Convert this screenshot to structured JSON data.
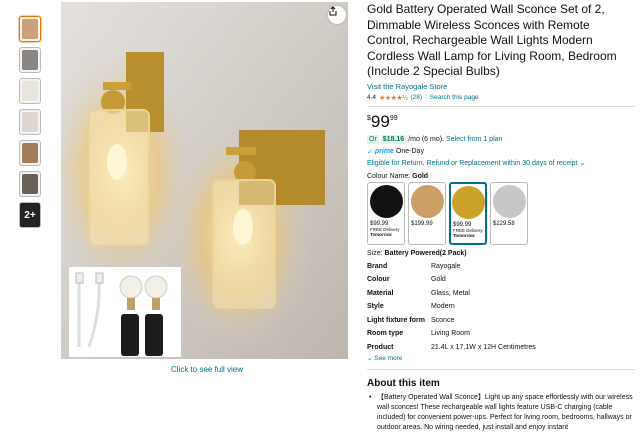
{
  "thumbnails": [
    {
      "name": "thumb-1",
      "color": "#c9a27a",
      "selected": true
    },
    {
      "name": "thumb-2",
      "color": "#8a8580",
      "selected": false
    },
    {
      "name": "thumb-3",
      "color": "#e9e5dc",
      "selected": false
    },
    {
      "name": "thumb-4",
      "color": "#dcd8cf",
      "selected": false
    },
    {
      "name": "thumb-5",
      "color": "#a37c58",
      "selected": false
    },
    {
      "name": "thumb-6",
      "color": "#6a6259",
      "selected": false
    }
  ],
  "thumb_more_label": "2+",
  "zoom_link": "Click to see full view",
  "product": {
    "title": "Gold Battery Operated Wall Sconce Set of 2, Dimmable Wireless Sconces with Remote Control, Rechargeable Wall Lights Modern Cordless Wall Lamp for Living Room, Bedroom (Include 2 Special Bulbs)",
    "store_link": "Visit the Rayogale Store",
    "rating": "4.4",
    "stars": "★★★★½",
    "reviews": "(28)",
    "search_link": "Search this page",
    "price_currency": "$",
    "price_whole": "99",
    "price_fraction": "99",
    "monthly_or": "Or",
    "monthly_amount": "$18.16",
    "monthly_text": "/mo (6 mo).",
    "monthly_link": "Select from 1 plan",
    "prime_check": "✓",
    "prime_logo": "prime",
    "prime_text": "One-Day",
    "eligible": "Eligible for Return, Refund or Replacement within 30 days of receipt ⌄",
    "colour_label": "Colour Name:",
    "colour_value": "Gold",
    "size_label": "Size:",
    "size_value": "Battery Powered(2 Pack)"
  },
  "swatches": [
    {
      "color": "#111111",
      "price": "$99.99",
      "delivery_1": "FREE Delivery",
      "delivery_2": "Tomorrow",
      "selected": false
    },
    {
      "color": "#caa066",
      "price": "$199.99",
      "delivery_1": "",
      "delivery_2": "",
      "selected": false
    },
    {
      "color": "#c9a227",
      "price": "$99.99",
      "delivery_1": "FREE Delivery",
      "delivery_2": "Tomorrow",
      "selected": true
    },
    {
      "color": "#c7c7c7",
      "price": "$229.58",
      "delivery_1": "",
      "delivery_2": "",
      "selected": false
    }
  ],
  "specs": [
    {
      "k": "Brand",
      "v": "Rayogale"
    },
    {
      "k": "Colour",
      "v": "Gold"
    },
    {
      "k": "Material",
      "v": "Glass, Metal"
    },
    {
      "k": "Style",
      "v": "Modern"
    },
    {
      "k": "Light fixture form",
      "v": "Sconce"
    },
    {
      "k": "Room type",
      "v": "Living Room"
    },
    {
      "k": "Product",
      "v": "21.4L x 17.1W x 12H Centimetres"
    }
  ],
  "see_more": "⌄ See more",
  "about_heading": "About this item",
  "bullet_1": "【Battery Operated Wall Sconce】Light up any space effortlessly with our wireless wall sconces! These rechargeable wall lights feature USB-C charging (cable included) for convenient power-ups. Perfect for living room, bedrooms, hallways or outdoor areas. No wiring needed, just install and enjoy instant"
}
